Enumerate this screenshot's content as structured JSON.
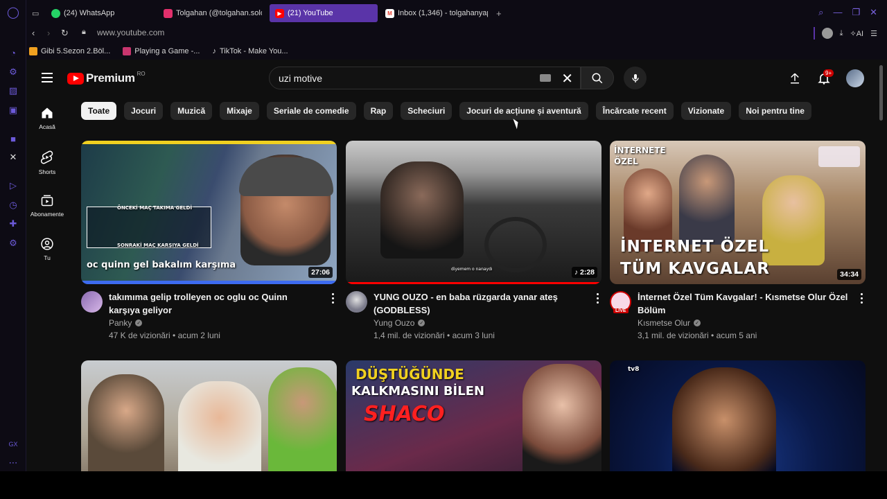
{
  "browser": {
    "tabs": [
      {
        "label": "(24) WhatsApp",
        "icon": "whatsapp-icon",
        "color": "#25d366"
      },
      {
        "label": "Tolgahan (@tolgahan.solo)",
        "icon": "instagram-icon",
        "color": "#e1306c"
      },
      {
        "label": "(21) YouTube",
        "icon": "youtube-icon",
        "color": "#ff0000",
        "active": true
      },
      {
        "label": "Inbox (1,346) - tolgahanyap",
        "icon": "gmail-icon",
        "color": "#ea4335"
      }
    ],
    "new_tab": "+",
    "url": "www.youtube.com",
    "ai_label": "AI",
    "bookmarks": [
      {
        "label": "Gibi 5.Sezon 2.Böl...",
        "color": "#f0a020"
      },
      {
        "label": "Playing a Game -...",
        "color": "#c8356e"
      },
      {
        "label": "TikTok - Make You...",
        "color": "#000000"
      }
    ]
  },
  "youtube": {
    "logo_text": "Premium",
    "region": "RO",
    "search_value": "uzi motive",
    "notification_count": "9+",
    "nav": [
      {
        "label": "Acasă",
        "icon": "home-icon"
      },
      {
        "label": "Shorts",
        "icon": "shorts-icon"
      },
      {
        "label": "Abonamente",
        "icon": "subscriptions-icon"
      },
      {
        "label": "Tu",
        "icon": "you-icon"
      }
    ],
    "chips": [
      "Toate",
      "Jocuri",
      "Muzică",
      "Mixaje",
      "Seriale de comedie",
      "Rap",
      "Scheciuri",
      "Jocuri de acțiune și aventură",
      "Încărcate recent",
      "Vizionate",
      "Noi pentru tine"
    ],
    "videos": [
      {
        "title": "takımıma gelip trolleyen oc oglu oc Quinn karşıya geliyor",
        "channel": "Panky",
        "meta": "47 K de vizionări • acum 2 luni",
        "duration": "27:06",
        "caption": "oc quinn gel bakalım karşıma",
        "caption_top": "ÖNCEKİ MAÇ TAKIMA GELDİ",
        "caption_bottom": "SONRAKİ MAÇ KARŞIYA GELDİ"
      },
      {
        "title": "YUNG OUZO - en baba rüzgarda yanar ateş (GODBLESS)",
        "channel": "Yung Ouzo",
        "meta": "1,4 mil. de vizionări • acum 3 luni",
        "duration": "2:28",
        "subtitle": "diyemem o nanaydı",
        "watched_fraction": 1.0
      },
      {
        "title": "İnternet Özel Tüm Kavgalar! - Kısmetse Olur Özel Bölüm",
        "channel": "Kısmetse Olur",
        "meta": "3,1 mil. de vizionări • acum 5 ani",
        "duration": "34:34",
        "caption_top": "İNTERNETE ÖZEL",
        "caption_line1": "İNTERNET ÖZEL",
        "caption_line2": "TÜM KAVGALAR",
        "live_badge": "LIVE"
      },
      {
        "title": "",
        "channel": "",
        "meta": ""
      },
      {
        "title": "",
        "channel": "",
        "meta": "",
        "caption_line1": "DÜŞTÜĞÜNDE",
        "caption_line2": "KALKMASINI BİLEN",
        "caption_line3": "SHACO"
      },
      {
        "title": "",
        "channel": "",
        "meta": "",
        "caption_top": "tv8"
      }
    ]
  },
  "colors": {
    "accent": "#5a34a8",
    "yt_red": "#ff0000",
    "background": "#0f0f0f"
  }
}
